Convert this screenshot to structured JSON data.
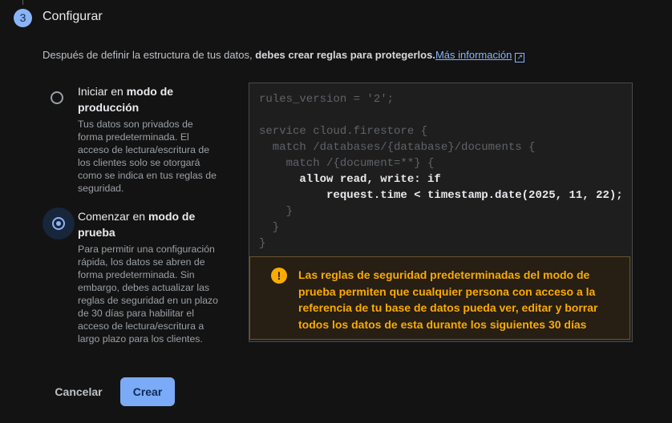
{
  "step": {
    "number": "3",
    "title": "Configurar"
  },
  "description": {
    "text": "Después de definir la estructura de tus datos, ",
    "bold": "debes crear reglas para protegerlos.",
    "link": "Más información"
  },
  "options": [
    {
      "label_prefix": "Iniciar en ",
      "label_bold": "modo de producción",
      "description": "Tus datos son privados de forma predeterminada. El acceso de lectura/escritura de los clientes solo se otorgará como se indica en tus reglas de seguridad.",
      "selected": false
    },
    {
      "label_prefix": "Comenzar en ",
      "label_bold": "modo de prueba",
      "description": "Para permitir una configuración rápida, los datos se abren de forma predeterminada. Sin embargo, debes actualizar las reglas de seguridad en un plazo de 30 días para habilitar el acceso de lectura/escritura a largo plazo para los clientes.",
      "selected": true
    }
  ],
  "code": {
    "l1": "rules_version = '2';",
    "l3": "service cloud.firestore {",
    "l4": "  match /databases/{database}/documents {",
    "l5": "    match /{document=**} {",
    "l6": "      allow read, write: if",
    "l7": "          request.time < timestamp.date(2025, 11, 22);",
    "l8": "    }",
    "l9": "  }",
    "l10": "}"
  },
  "warning": {
    "icon": "exclamation-icon",
    "text": "Las reglas de seguridad predeterminadas del modo de prueba permiten que cualquier persona con acceso a la referencia de tu base de datos pueda ver, editar y borrar todos los datos de esta durante los siguientes 30 días"
  },
  "buttons": {
    "cancel": "Cancelar",
    "create": "Crear"
  },
  "colors": {
    "accent": "#8ab4f8",
    "warning": "#f9ab00",
    "background": "#131313"
  }
}
